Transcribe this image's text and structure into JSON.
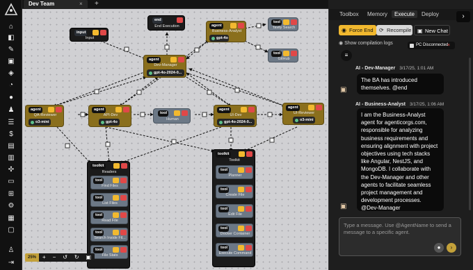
{
  "app": {
    "tab_title": "Dev Team",
    "tab_close": "×",
    "tab_add": "+"
  },
  "rail_icons": [
    "logo-icon",
    "home-icon",
    "tools-icon",
    "wrench-icon",
    "robot-icon",
    "cube-icon",
    "chat-icon",
    "people-icon",
    "list-icon",
    "dollar-icon",
    "file-icon",
    "puzzle-icon",
    "monitor-icon",
    "gear-icon",
    "chart-icon",
    "message-icon",
    "user-icon",
    "logout-icon"
  ],
  "canvas": {
    "zoom": "25%",
    "controls": [
      "+",
      "−",
      "↺",
      "↻",
      "▣"
    ],
    "nodes": {
      "input": {
        "chip": "input",
        "label": "Input"
      },
      "end": {
        "chip": "end",
        "label": "End Execution"
      },
      "business_analyst": {
        "chip": "agent",
        "label": "Business-Analyst",
        "model": "gpt-4o"
      },
      "tavily": {
        "chip": "tool",
        "label": "Tavily Search"
      },
      "github": {
        "chip": "tool",
        "label": "GitHub"
      },
      "dev_manager": {
        "chip": "agent",
        "label": "Dev-Manager",
        "model": "gpt-4o-2024-0..."
      },
      "qa_reviewer": {
        "chip": "agent",
        "label": "QA-Reviewer",
        "model": "o3-mini"
      },
      "api_dev": {
        "chip": "agent",
        "label": "API-Dev",
        "model": "gpt-4o"
      },
      "human": {
        "chip": "tool",
        "label": "Human"
      },
      "ui_dev": {
        "chip": "agent",
        "label": "UI-Dev",
        "model": "gpt-4o-2024-0..."
      },
      "ui_reviewer": {
        "chip": "agent",
        "label": "UI-Reviewer",
        "model": "o3-mini"
      },
      "readers": {
        "chip": "toolkit",
        "label": "Readers",
        "items": [
          {
            "chip": "tool",
            "label": "Find Files"
          },
          {
            "chip": "tool",
            "label": "List Files"
          },
          {
            "chip": "tool",
            "label": "Read File"
          },
          {
            "chip": "tool",
            "label": "Search Inside Fil..."
          },
          {
            "chip": "tool",
            "label": "File Stats"
          }
        ]
      },
      "toolkit": {
        "chip": "toolkit",
        "label": "Toolkit",
        "items": [
          {
            "chip": "tool",
            "label": "Planner"
          },
          {
            "chip": "tool",
            "label": "Create File"
          },
          {
            "chip": "tool",
            "label": "Edit File"
          },
          {
            "chip": "tool",
            "label": "Docker Container"
          },
          {
            "chip": "tool",
            "label": "Execute Command"
          }
        ]
      }
    }
  },
  "panel": {
    "tabs": [
      "Toolbox",
      "Memory",
      "Execute",
      "Deploy"
    ],
    "active_tab": "Execute",
    "close": "›",
    "buttons": {
      "force_end": "Force End",
      "recompile": "Recompile",
      "new_chat": "New Chat"
    },
    "show_logs": "Show compilation logs",
    "status": "PC Disconnected",
    "status_close": "×",
    "menu": "≡",
    "messages": [
      {
        "sender": "AI - Dev-Manager",
        "time": "3/17/25, 1:01 AM",
        "text": "The BA has introduced themselves. @end"
      },
      {
        "sender": "AI - Business-Analyst",
        "time": "3/17/25, 1:06 AM",
        "text": "I am the Business-Analyst agent for agenticorgs.com, responsible for analyzing business requirements and ensuring alignment with project objectives using tech stacks like Angular, NestJS, and MongoDB. I collaborate with the Dev-Manager and other agents to facilitate seamless project management and development processes. @Dev-Manager"
      }
    ],
    "compose_placeholder": "Type a message. Use @AgentName to send a message to a specific agent."
  }
}
